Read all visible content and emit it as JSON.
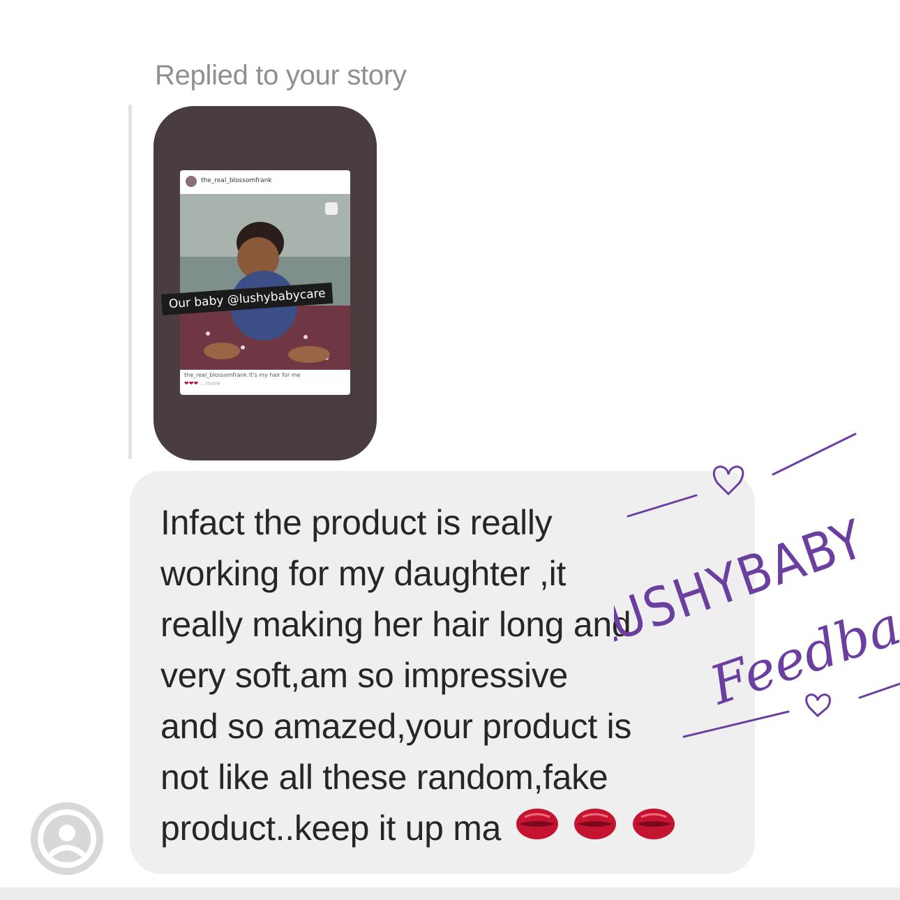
{
  "reply": {
    "label": "Replied to your story"
  },
  "story": {
    "post_username": "the_real_blossomfrank",
    "sticker_text": "Our baby @lushybabycare",
    "caption_text": "the_real_blossomfrank It's my hair for me",
    "caption_hearts": "❤❤❤",
    "caption_more": "...more"
  },
  "message": {
    "lines": [
      "Infact the product is really",
      "working for my daughter ,it",
      "really making her hair long and",
      "very soft,am so impressive",
      "and so amazed,your product is",
      "not like all these random,fake",
      "product..keep it up ma"
    ],
    "emoji": [
      "kiss-mark-icon",
      "kiss-mark-icon",
      "kiss-mark-icon"
    ]
  },
  "watermark": {
    "line1": "LUSHYBABY",
    "line2": "Feedback"
  },
  "colors": {
    "bubble": "#efefef",
    "text": "#262626",
    "story_bg": "#4a3d40",
    "watermark": "#6b3fa0",
    "lips": "#c4142f"
  }
}
